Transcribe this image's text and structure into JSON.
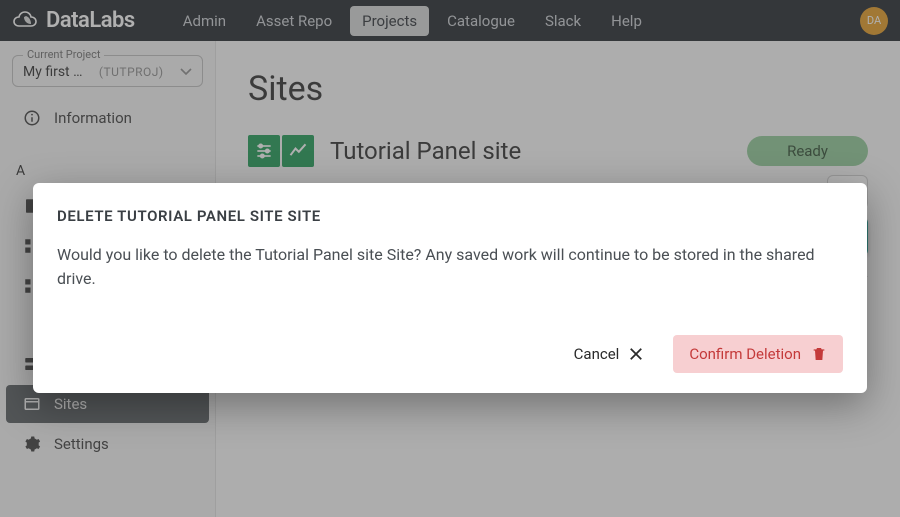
{
  "header": {
    "brand": "DataLabs",
    "nav": [
      "Admin",
      "Asset Repo",
      "Projects",
      "Catalogue",
      "Slack",
      "Help"
    ],
    "active_nav_index": 2,
    "avatar_initials": "DA"
  },
  "sidebar": {
    "project_selector": {
      "label": "Current Project",
      "name": "My first …",
      "code": "(TUTPROJ)"
    },
    "info_label": "Information",
    "analysis_heading": "A",
    "items_group1": [
      "",
      "",
      ""
    ],
    "items_group2": {
      "sites": "Sites",
      "settings": "Settings"
    },
    "active_item": "sites"
  },
  "main": {
    "page_title": "Sites",
    "site": {
      "name": "Tutorial Panel site",
      "status": "Ready"
    }
  },
  "dialog": {
    "title": "DELETE TUTORIAL PANEL SITE SITE",
    "body": "Would you like to delete the Tutorial Panel site Site? Any saved work will continue to be stored in the shared drive.",
    "cancel_label": "Cancel",
    "confirm_label": "Confirm Deletion"
  }
}
